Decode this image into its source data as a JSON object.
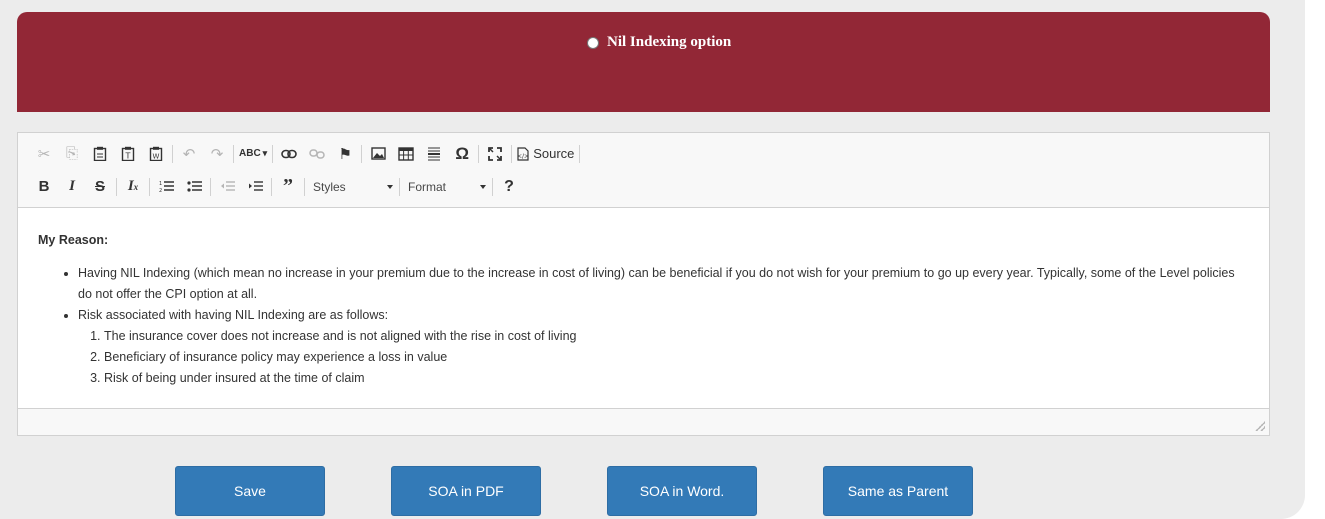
{
  "banner": {
    "option_label": "Nil Indexing option",
    "bg_color": "#922736"
  },
  "toolbar": {
    "row1": [
      {
        "icon": "cut-icon",
        "glyph": "✂",
        "enabled": false
      },
      {
        "icon": "copy-icon",
        "glyph": "⎘",
        "enabled": false
      },
      {
        "icon": "paste-icon",
        "glyph": "📋",
        "enabled": true
      },
      {
        "icon": "paste-text-icon",
        "glyph": "📋",
        "enabled": true
      },
      {
        "icon": "paste-word-icon",
        "glyph": "📋",
        "enabled": true
      },
      {
        "icon": "undo-icon",
        "glyph": "↶",
        "enabled": false
      },
      {
        "icon": "redo-icon",
        "glyph": "↷",
        "enabled": false
      },
      {
        "icon": "spellcheck-icon",
        "glyph": "ABC✓",
        "enabled": true
      },
      {
        "icon": "link-icon",
        "glyph": "🔗",
        "enabled": true
      },
      {
        "icon": "unlink-icon",
        "glyph": "⛓",
        "enabled": false
      },
      {
        "icon": "anchor-flag-icon",
        "glyph": "⚑",
        "enabled": true
      },
      {
        "icon": "image-icon",
        "glyph": "🖼",
        "enabled": true
      },
      {
        "icon": "table-icon",
        "glyph": "▦",
        "enabled": true
      },
      {
        "icon": "horizontal-line-icon",
        "glyph": "☰",
        "enabled": true
      },
      {
        "icon": "special-char-icon",
        "glyph": "Ω",
        "enabled": true
      },
      {
        "icon": "maximize-icon",
        "glyph": "⛶",
        "enabled": true
      }
    ],
    "source_label": "Source",
    "styles_label": "Styles",
    "format_label": "Format",
    "help_glyph": "?"
  },
  "content": {
    "reason_heading": "My Reason:",
    "bullet1": "Having NIL Indexing (which mean no increase in your premium due to the increase in cost of living) can be beneficial if you do not wish for your premium to go up every year. Typically, some of the Level policies do not offer the CPI option at all.",
    "bullet2": "Risk associated with having NIL Indexing are as follows:",
    "risks": [
      "The insurance cover does not increase and is not aligned with the rise in cost of living",
      "Beneficiary of insurance policy may experience a loss in value",
      "Risk of being under insured at the time of claim"
    ]
  },
  "buttons": {
    "save": "Save",
    "soa_pdf": "SOA in PDF",
    "soa_word": "SOA in Word.",
    "same_parent": "Same as Parent",
    "color": "#337ab7"
  }
}
